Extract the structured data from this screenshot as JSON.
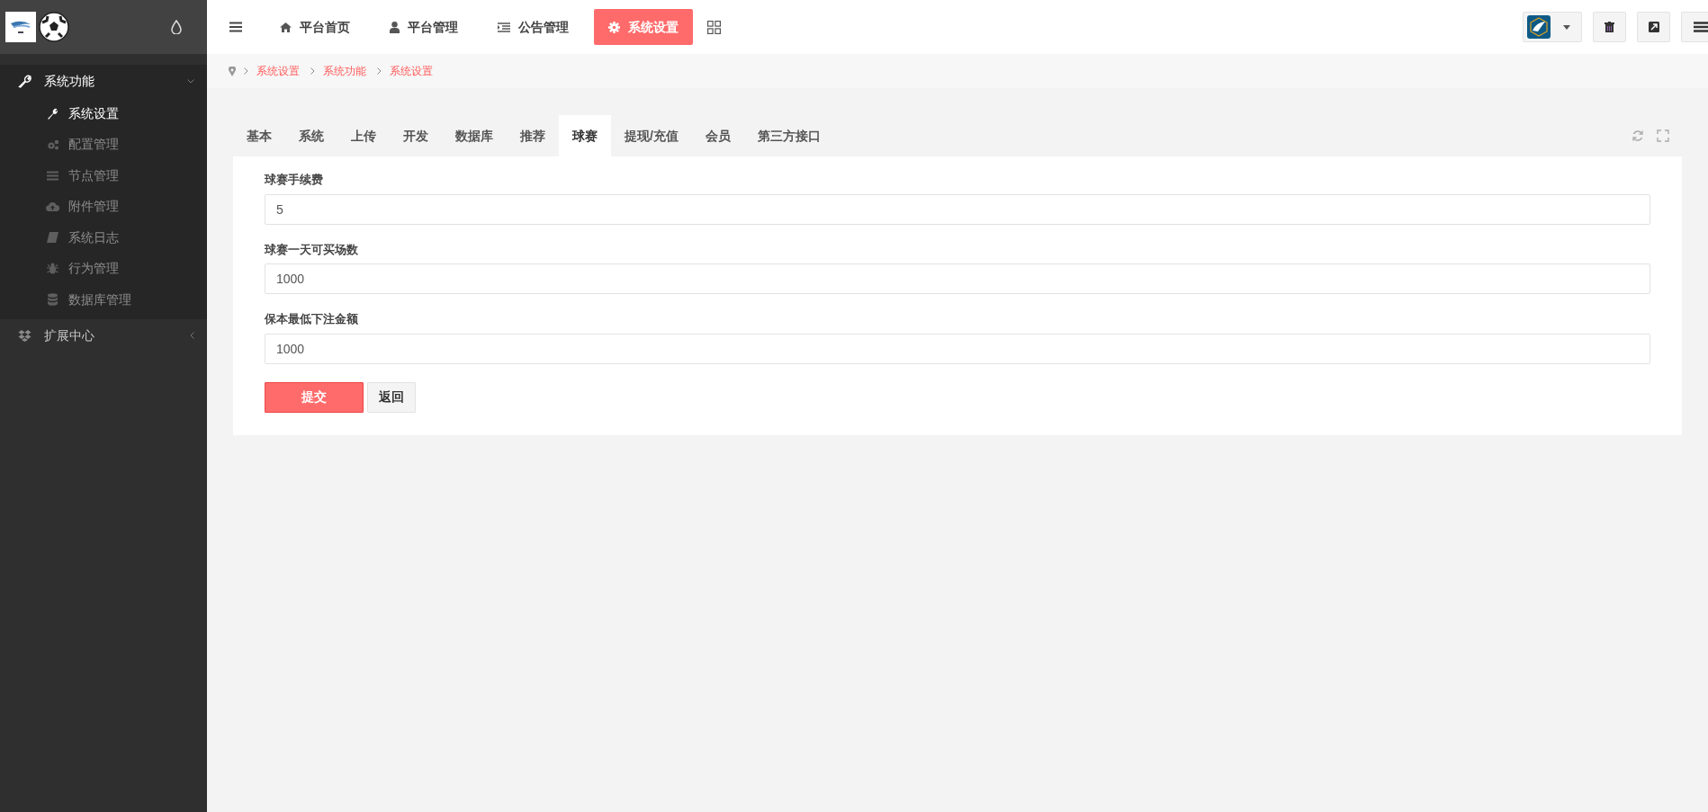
{
  "sidebar": {
    "groups": [
      {
        "label": "系统功能",
        "expanded": true,
        "children": [
          {
            "label": "系统设置",
            "selected": true
          },
          {
            "label": "配置管理",
            "selected": false
          },
          {
            "label": "节点管理",
            "selected": false
          },
          {
            "label": "附件管理",
            "selected": false
          },
          {
            "label": "系统日志",
            "selected": false
          },
          {
            "label": "行为管理",
            "selected": false
          },
          {
            "label": "数据库管理",
            "selected": false
          }
        ]
      },
      {
        "label": "扩展中心",
        "expanded": false
      }
    ]
  },
  "top_nav": {
    "items": [
      {
        "label": "平台首页",
        "selected": false
      },
      {
        "label": "平台管理",
        "selected": false
      },
      {
        "label": "公告管理",
        "selected": false
      },
      {
        "label": "系统设置",
        "selected": true
      }
    ]
  },
  "breadcrumb": [
    "系统设置",
    "系统功能",
    "系统设置"
  ],
  "tabs": [
    {
      "label": "基本",
      "selected": false
    },
    {
      "label": "系统",
      "selected": false
    },
    {
      "label": "上传",
      "selected": false
    },
    {
      "label": "开发",
      "selected": false
    },
    {
      "label": "数据库",
      "selected": false
    },
    {
      "label": "推荐",
      "selected": false
    },
    {
      "label": "球赛",
      "selected": true
    },
    {
      "label": "提现/充值",
      "selected": false
    },
    {
      "label": "会员",
      "selected": false
    },
    {
      "label": "第三方接口",
      "selected": false
    }
  ],
  "form": {
    "fields": [
      {
        "label": "球赛手续费",
        "value": "5"
      },
      {
        "label": "球赛一天可买场数",
        "value": "1000"
      },
      {
        "label": "保本最低下注金额",
        "value": "1000"
      }
    ],
    "buttons": [
      {
        "label": "提交",
        "kind": "primary"
      },
      {
        "label": "返回",
        "kind": "default"
      }
    ]
  }
}
